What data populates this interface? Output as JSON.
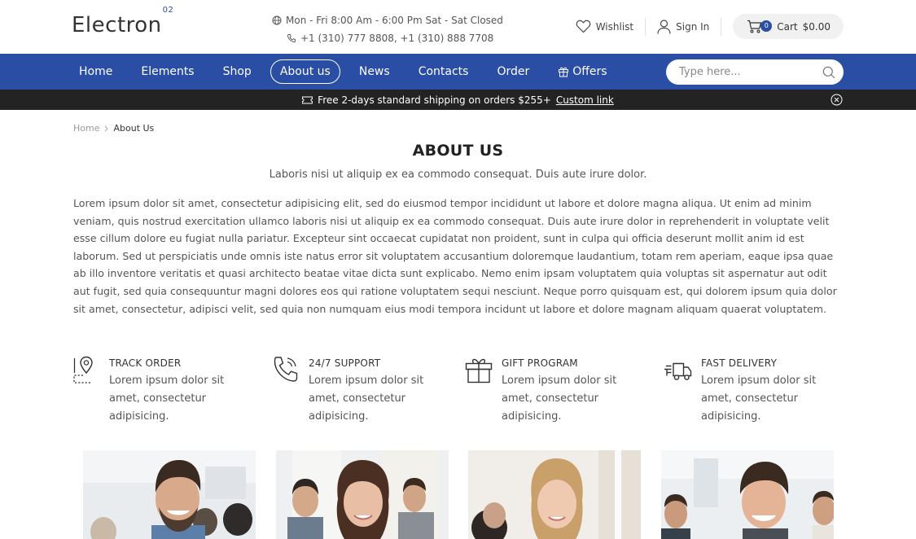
{
  "header": {
    "logo_text": "Electron",
    "logo_sup": "02",
    "hours": "Mon - Fri 8:00 Am - 6:00 Pm Sat - Sat Closed",
    "phones": "+1 (310) 777 8808, +1 (310) 888 7708",
    "wishlist_label": "Wishlist",
    "signin_label": "Sign In",
    "cart_count": "0",
    "cart_label": "Cart",
    "cart_total": "$0.00"
  },
  "nav": {
    "items": [
      {
        "label": "Home"
      },
      {
        "label": "Elements"
      },
      {
        "label": "Shop"
      },
      {
        "label": "About us",
        "active": true
      },
      {
        "label": "News"
      },
      {
        "label": "Contacts"
      },
      {
        "label": "Order"
      },
      {
        "label": "Offers",
        "icon": "gift-icon"
      }
    ],
    "search_placeholder": "Type here..."
  },
  "promo": {
    "text": "Free 2-days standard shipping on orders $255+",
    "link_text": "Custom link"
  },
  "breadcrumb": {
    "home": "Home",
    "current": "About Us"
  },
  "main": {
    "title": "ABOUT US",
    "subtitle": "Laboris nisi ut aliquip ex ea commodo consequat. Duis aute irure dolor.",
    "body": "Lorem ipsum dolor sit amet, consectetur adipisicing elit, sed do eiusmod tempor incididunt ut labore et dolore magna aliqua. Ut enim ad minim veniam, quis nostrud exercitation ullamco laboris nisi ut aliquip ex ea commodo consequat. Duis aute irure dolor in reprehenderit in voluptate velit esse cillum dolore eu fugiat nulla pariatur. Excepteur sint occaecat cupidatat non proident, sunt in culpa qui officia deserunt mollit anim id est laborum. Sed ut perspiciatis unde omnis iste natus error sit voluptatem accusantium doloremque laudantium, totam rem aperiam, eaque ipsa quae ab illo inventore veritatis et quasi architecto beatae vitae dicta sunt explicabo. Nemo enim ipsam voluptatem quia voluptas sit aspernatur aut odit aut fugit, sed quia consequuntur magni dolores eos qui ratione voluptatem sequi nesciunt. Neque porro quisquam est, qui dolorem ipsum quia dolor sit amet, consectetur, adipisci velit, sed quia non numquam eius modi tempora incidunt ut labore et dolore magnam aliquam quaerat voluptatem."
  },
  "features": [
    {
      "title": "TRACK ORDER",
      "desc": "Lorem ipsum dolor sit amet, consectetur adipisicing.",
      "icon": "map-pin-icon"
    },
    {
      "title": "24/7 SUPPORT",
      "desc": "Lorem ipsum dolor sit amet, consectetur adipisicing.",
      "icon": "phone-icon"
    },
    {
      "title": "GIFT PROGRAM",
      "desc": "Lorem ipsum dolor sit amet, consectetur adipisicing.",
      "icon": "gift-icon"
    },
    {
      "title": "FAST DELIVERY",
      "desc": "Lorem ipsum dolor sit amet, consectetur adipisicing.",
      "icon": "truck-icon"
    }
  ],
  "team": [
    {
      "icon": "team-photo-man-smiling"
    },
    {
      "icon": "team-photo-woman-brunette"
    },
    {
      "icon": "team-photo-woman-blonde"
    },
    {
      "icon": "team-photo-young-man"
    }
  ],
  "colors": {
    "brand_blue": "#2a4ea3",
    "promo_bar": "#232323"
  }
}
